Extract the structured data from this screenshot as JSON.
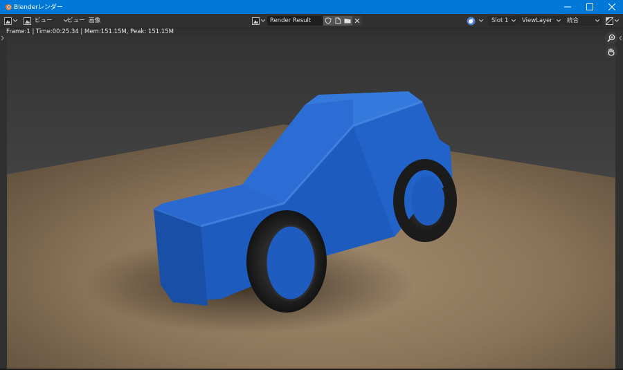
{
  "window": {
    "title": "Blenderレンダー",
    "accent": "#0078d7"
  },
  "header": {
    "menus": [
      "ビュー",
      "ビュー",
      "画像"
    ],
    "image_name": "Render Result",
    "slot": "Slot 1",
    "view_layer": "ViewLayer",
    "pass": "統合"
  },
  "status": {
    "text": "Frame:1 | Time:00:25.34 | Mem:151.15M, Peak: 151.15M"
  },
  "render": {
    "subject": "blue toy car",
    "body_color": "#1f5fc4",
    "floor_color": "#8a7255",
    "background_color": "#3f3f3f"
  },
  "icons": {
    "editor_type": "image-editor-icon",
    "display_mode": "image-display-icon",
    "zoom": "zoom-icon",
    "pan": "hand-icon"
  }
}
